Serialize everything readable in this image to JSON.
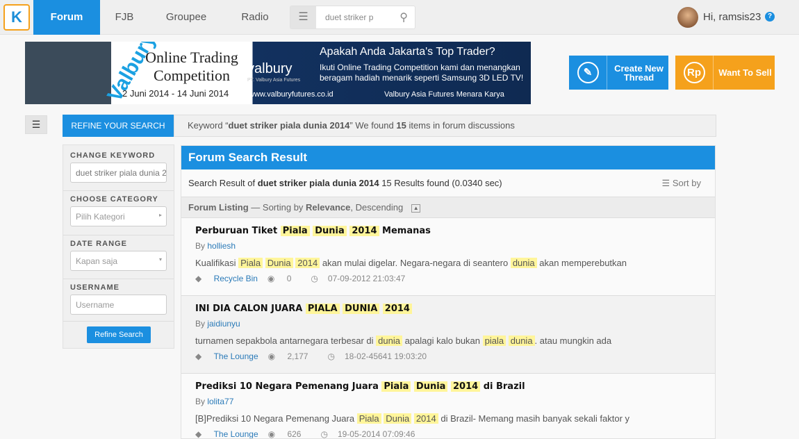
{
  "nav": {
    "logo": "K",
    "tabs": [
      "Forum",
      "FJB",
      "Groupee",
      "Radio"
    ],
    "search_value": "duet striker p",
    "user_greeting": "Hi, ramsis23",
    "help_icon": "question-circle-icon"
  },
  "banner": {
    "brand": "Valbury",
    "title": "Online Trading Competition",
    "dates": "2 Juni 2014 - 14 Juni 2014",
    "logo": "valbury",
    "company": "PT. Valbury Asia Futures",
    "headline": "Apakah Anda Jakarta's Top Trader?",
    "sub": "Ikuti Online Trading Competition kami dan menangkan beragam hadiah menarik seperti Samsung 3D LED TV!",
    "url": "www.valburyfutures.co.id",
    "facebook": "Valbury Asia Futures Menara Karya"
  },
  "actions": {
    "create": "Create New Thread",
    "sell": "Want To Sell",
    "sell_icon_text": "Rp"
  },
  "refine": {
    "tab": "REFINE YOUR SEARCH",
    "kw_pre": "Keyword “",
    "kw": "duet striker piala dunia 2014",
    "kw_mid": "” We found ",
    "count": "15",
    "kw_post": " items in forum discussions"
  },
  "sidebar": {
    "change_keyword": "CHANGE KEYWORD",
    "keyword_value": "duet striker piala dunia 2014",
    "choose_category": "CHOOSE CATEGORY",
    "category_placeholder": "Pilih Kategori",
    "date_range": "DATE RANGE",
    "date_value": "Kapan saja",
    "username": "USERNAME",
    "username_placeholder": "Username",
    "button": "Refine Search"
  },
  "results": {
    "header": "Forum Search Result",
    "sum_pre": "Search Result of ",
    "sum_kw": "duet striker piala dunia 2014",
    "sum_post": " 15 Results found (0.0340 sec)",
    "sort": "Sort by",
    "listing": "Forum Listing",
    "listing_mid": " — Sorting by ",
    "relevance": "Relevance",
    "order": ", Descending",
    "items": [
      {
        "title": [
          [
            "Perburuan Tiket ",
            0
          ],
          [
            "Piala",
            1
          ],
          [
            " ",
            0
          ],
          [
            "Dunia",
            1
          ],
          [
            " ",
            0
          ],
          [
            "2014",
            1
          ],
          [
            " Memanas",
            0
          ]
        ],
        "author": "holliesh",
        "snippet": [
          [
            "Kualifikasi ",
            0
          ],
          [
            "Piala",
            1
          ],
          [
            " ",
            0
          ],
          [
            "Dunia",
            1
          ],
          [
            " ",
            0
          ],
          [
            "2014",
            1
          ],
          [
            " akan mulai digelar. Negara-negara di seantero ",
            0
          ],
          [
            "dunia",
            1
          ],
          [
            " akan memperebutkan",
            0
          ]
        ],
        "category": "Recycle Bin",
        "views": "0",
        "date": "07-09-2012 21:03:47"
      },
      {
        "title": [
          [
            "INI DIA CALON JUARA ",
            0
          ],
          [
            "PIALA",
            1
          ],
          [
            " ",
            0
          ],
          [
            "DUNIA",
            1
          ],
          [
            " ",
            0
          ],
          [
            "2014",
            1
          ]
        ],
        "author": "jaidiunyu",
        "snippet": [
          [
            "turnamen sepakbola antarnegara terbesar di ",
            0
          ],
          [
            "dunia",
            1
          ],
          [
            " apalagi kalo bukan ",
            0
          ],
          [
            "piala",
            1
          ],
          [
            " ",
            0
          ],
          [
            "dunia",
            1
          ],
          [
            ". atau mungkin ada",
            0
          ]
        ],
        "category": "The Lounge",
        "views": "2,177",
        "date": "18-02-45641 19:03:20"
      },
      {
        "title": [
          [
            "Prediksi 10 Negara Pemenang Juara ",
            0
          ],
          [
            "Piala",
            1
          ],
          [
            " ",
            0
          ],
          [
            "Dunia",
            1
          ],
          [
            " ",
            0
          ],
          [
            "2014",
            1
          ],
          [
            " di Brazil",
            0
          ]
        ],
        "author": "lolita77",
        "snippet": [
          [
            "[B]Prediksi 10 Negara Pemenang Juara ",
            0
          ],
          [
            "Piala",
            1
          ],
          [
            " ",
            0
          ],
          [
            "Dunia",
            1
          ],
          [
            " ",
            0
          ],
          [
            "2014",
            1
          ],
          [
            " di Brazil- Memang masih banyak sekali faktor y",
            0
          ]
        ],
        "category": "The Lounge",
        "views": "626",
        "date": "19-05-2014 07:09:46"
      }
    ]
  },
  "colors": {
    "primary": "#1b8fe0",
    "create": "#1b8fe0",
    "sell": "#f5a11c",
    "highlight": "#fff59a"
  }
}
